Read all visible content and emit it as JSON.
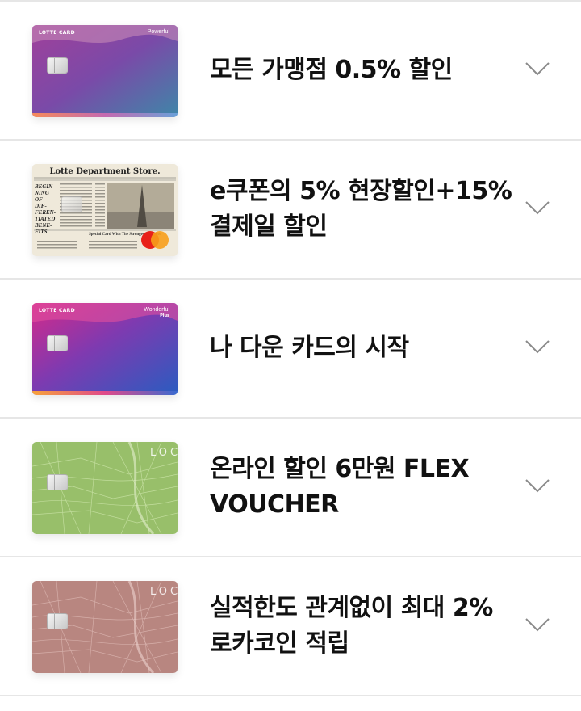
{
  "items": [
    {
      "title": "모든 가맹점 0.5% 할인",
      "card": {
        "brand": "LOTTE CARD",
        "product": "Powerful"
      }
    },
    {
      "title": "e쿠폰의 5% 현장할인+15% 결제일 할인",
      "card": {
        "masthead": "Lotte Department Store.",
        "side_text": "BEGIN-\nNING\nOF\nDIF-\nFEREN-\nTIATED\nBENE-\nFITS",
        "caption": "Special Card With The Strongest Benefits"
      }
    },
    {
      "title": "나 다운 카드의 시작",
      "card": {
        "brand": "LOTTE CARD",
        "product": "Wonderful",
        "sub": "Plus"
      }
    },
    {
      "title": "온라인 할인 6만원 FLEX VOUCHER",
      "card": {
        "logo": "LOCA"
      }
    },
    {
      "title": "실적한도 관계없이 최대 2% 로카코인 적립",
      "card": {
        "logo": "LOCA"
      }
    }
  ],
  "icons": {
    "expand": "chevron-down-icon"
  },
  "colors": {
    "divider": "#e6e6e6",
    "text": "#111111",
    "chevron": "#8a8a8a"
  }
}
